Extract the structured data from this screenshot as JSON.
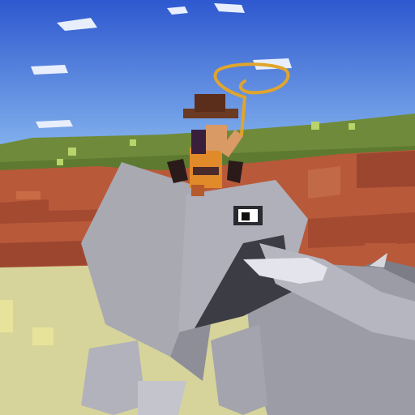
{
  "scene": {
    "kind": "voxel-game-view",
    "description_icons": [
      "cloud-icon",
      "lasso-icon",
      "elephant-icon",
      "rider-icon",
      "bush-icon"
    ],
    "colors": {
      "sky_top": "#3460d4",
      "sky_bottom": "#7fb3ef",
      "cliff": "#b8593a",
      "cliff_shadow": "#9c4630",
      "grass_top": "#6f8a3a",
      "ground": "#d8d69c",
      "elephant": "#a8a8b0",
      "elephant_shadow": "#808088",
      "tusk": "#e4e4ea",
      "rope": "#e0a52c",
      "hat": "#6b3a22",
      "skin": "#d99a66",
      "outfit": "#e08a2a",
      "hair": "#3a1f3c"
    }
  }
}
